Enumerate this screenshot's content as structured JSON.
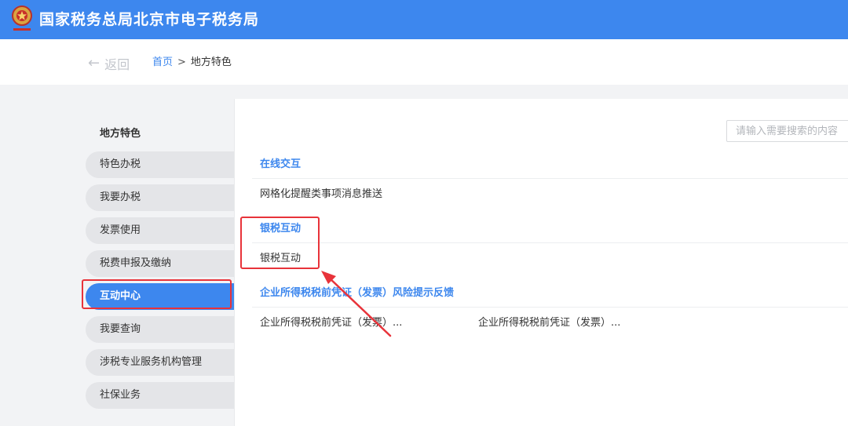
{
  "header": {
    "title": "国家税务总局北京市电子税务局"
  },
  "topbar": {
    "back_label": "返回",
    "breadcrumb": {
      "home": "首页",
      "separator": ">",
      "current": "地方特色"
    }
  },
  "sidebar": {
    "heading": "地方特色",
    "items": [
      {
        "label": "特色办税",
        "active": false
      },
      {
        "label": "我要办税",
        "active": false
      },
      {
        "label": "发票使用",
        "active": false
      },
      {
        "label": "税费申报及缴纳",
        "active": false
      },
      {
        "label": "互动中心",
        "active": true
      },
      {
        "label": "我要查询",
        "active": false
      },
      {
        "label": "涉税专业服务机构管理",
        "active": false
      },
      {
        "label": "社保业务",
        "active": false
      }
    ]
  },
  "main": {
    "search": {
      "placeholder": "请输入需要搜索的内容"
    },
    "sections": [
      {
        "title": "在线交互",
        "links": [
          "网格化提醒类事项消息推送"
        ]
      },
      {
        "title": "银税互动",
        "links": [
          "银税互动"
        ]
      },
      {
        "title": "企业所得税税前凭证（发票）风险提示反馈",
        "links": [
          "企业所得税税前凭证（发票）...",
          "企业所得税税前凭证（发票）..."
        ]
      }
    ]
  },
  "colors": {
    "brand_blue": "#3d87ee",
    "annotation_red": "#e8333a",
    "sidebar_gray": "#e4e5e8"
  },
  "icons": [
    "tax-emblem-icon",
    "back-arrow-icon"
  ]
}
